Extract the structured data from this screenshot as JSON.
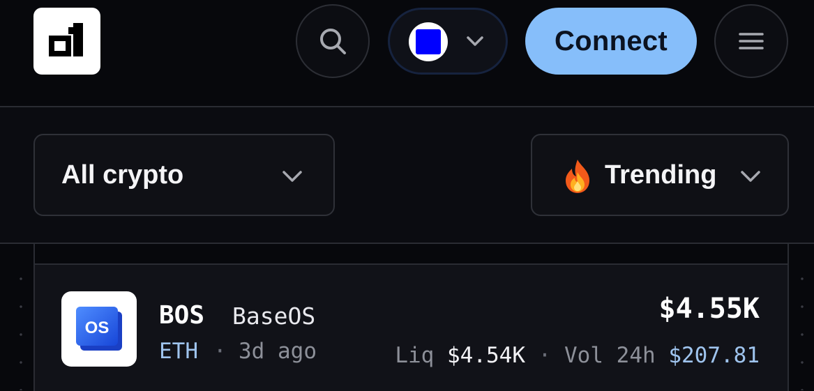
{
  "header": {
    "logo_label": "o1",
    "network": {
      "icon": "network-square-icon",
      "color": "#0000ff"
    },
    "connect_label": "Connect"
  },
  "filters": {
    "category": "All crypto",
    "sort": {
      "emoji": "🔥",
      "label": "Trending"
    }
  },
  "tokens": [
    {
      "symbol": "BOS",
      "name": "BaseOS",
      "logo_text": "OS",
      "chain": "ETH",
      "separator": "·",
      "age": "3d ago",
      "price": "$4.55K",
      "liq_label": "Liq",
      "liq_value": "$4.54K",
      "vol_label": "Vol 24h",
      "vol_value": "$207.81"
    }
  ],
  "colors": {
    "accent": "#86befa",
    "chain_text": "#9fc4ee",
    "background": "#07080c"
  }
}
